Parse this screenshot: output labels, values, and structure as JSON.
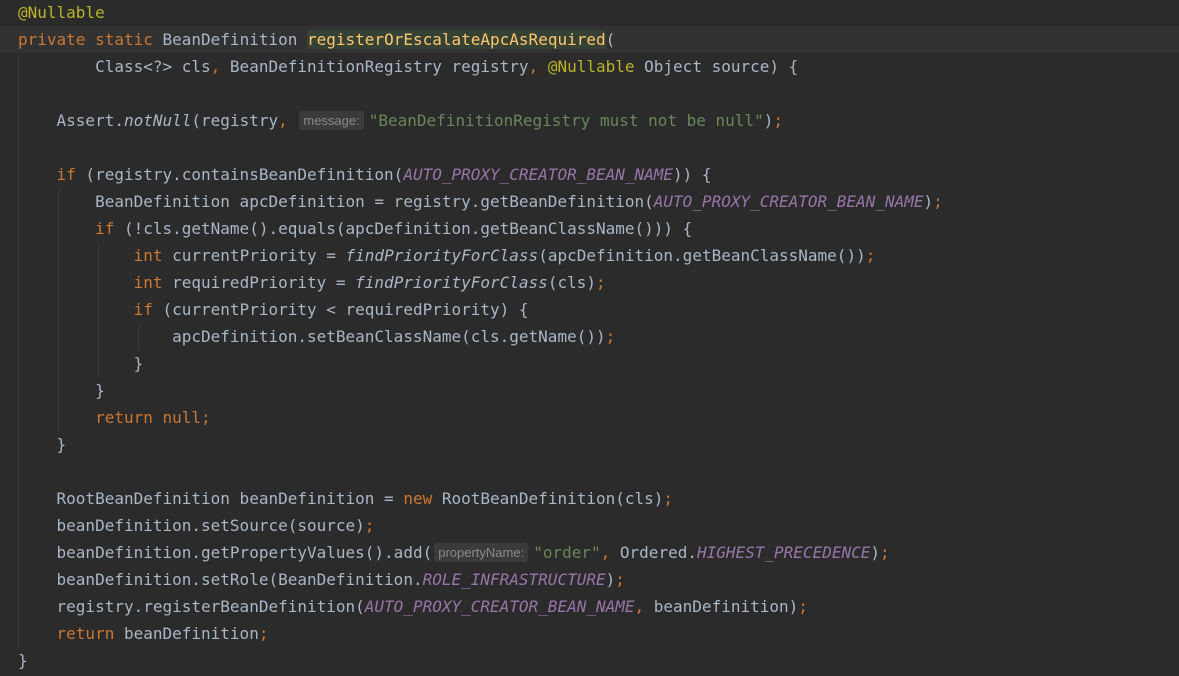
{
  "editor": {
    "theme_colors": {
      "background": "#2b2b2b",
      "current_line": "#323232",
      "keyword": "#cc7832",
      "annotation": "#bbb529",
      "method_declaration": "#ffc66d",
      "constant": "#9876aa",
      "string": "#6a8759",
      "default_text": "#a9b7c6",
      "hint_background": "#3b3b3b",
      "hint_text": "#8a8a8a"
    },
    "lines": [
      {
        "text": [
          {
            "t": "@Nullable",
            "c": "ann"
          }
        ]
      },
      {
        "current": true,
        "text": [
          {
            "t": "private static ",
            "c": "kw"
          },
          {
            "t": "BeanDefinition "
          },
          {
            "t": "registerOrEscalateApcAsRequired",
            "c": "fn-decl fn-hl"
          },
          {
            "t": "("
          }
        ]
      },
      {
        "text": [
          {
            "t": "        Class<?> cls"
          },
          {
            "t": ", ",
            "c": "kw"
          },
          {
            "t": "BeanDefinitionRegistry registry"
          },
          {
            "t": ", ",
            "c": "kw"
          },
          {
            "t": "@Nullable",
            "c": "ann"
          },
          {
            "t": " Object source) {"
          }
        ]
      },
      {
        "text": []
      },
      {
        "text": [
          {
            "t": "    Assert."
          },
          {
            "t": "notNull",
            "c": "static"
          },
          {
            "t": "(registry"
          },
          {
            "t": ", ",
            "c": "kw"
          },
          {
            "hint": "message:"
          },
          {
            "t": "\"BeanDefinitionRegistry must not be null\"",
            "c": "str"
          },
          {
            "t": ")"
          },
          {
            "t": ";",
            "c": "kw"
          }
        ]
      },
      {
        "text": []
      },
      {
        "text": [
          {
            "t": "    "
          },
          {
            "t": "if",
            "c": "kw"
          },
          {
            "t": " (registry.containsBeanDefinition("
          },
          {
            "t": "AUTO_PROXY_CREATOR_BEAN_NAME",
            "c": "const"
          },
          {
            "t": ")) {"
          }
        ]
      },
      {
        "text": [
          {
            "t": "        BeanDefinition apcDefinition = registry.getBeanDefinition("
          },
          {
            "t": "AUTO_PROXY_CREATOR_BEAN_NAME",
            "c": "const"
          },
          {
            "t": ")"
          },
          {
            "t": ";",
            "c": "kw"
          }
        ]
      },
      {
        "text": [
          {
            "t": "        "
          },
          {
            "t": "if",
            "c": "kw"
          },
          {
            "t": " (!cls.getName().equals(apcDefinition.getBeanClassName())) {"
          }
        ]
      },
      {
        "text": [
          {
            "t": "            "
          },
          {
            "t": "int",
            "c": "kw"
          },
          {
            "t": " currentPriority = "
          },
          {
            "t": "findPriorityForClass",
            "c": "static"
          },
          {
            "t": "(apcDefinition.getBeanClassName())"
          },
          {
            "t": ";",
            "c": "kw"
          }
        ]
      },
      {
        "text": [
          {
            "t": "            "
          },
          {
            "t": "int",
            "c": "kw"
          },
          {
            "t": " requiredPriority = "
          },
          {
            "t": "findPriorityForClass",
            "c": "static"
          },
          {
            "t": "(cls)"
          },
          {
            "t": ";",
            "c": "kw"
          }
        ]
      },
      {
        "text": [
          {
            "t": "            "
          },
          {
            "t": "if",
            "c": "kw"
          },
          {
            "t": " (currentPriority < requiredPriority) {"
          }
        ]
      },
      {
        "text": [
          {
            "t": "                apcDefinition.setBeanClassName(cls.getName())"
          },
          {
            "t": ";",
            "c": "kw"
          }
        ]
      },
      {
        "text": [
          {
            "t": "            }"
          }
        ]
      },
      {
        "text": [
          {
            "t": "        }"
          }
        ]
      },
      {
        "text": [
          {
            "t": "        "
          },
          {
            "t": "return null",
            "c": "kw"
          },
          {
            "t": ";",
            "c": "kw"
          }
        ]
      },
      {
        "text": [
          {
            "t": "    }"
          }
        ]
      },
      {
        "text": []
      },
      {
        "text": [
          {
            "t": "    RootBeanDefinition beanDefinition = "
          },
          {
            "t": "new",
            "c": "kw"
          },
          {
            "t": " RootBeanDefinition(cls)"
          },
          {
            "t": ";",
            "c": "kw"
          }
        ]
      },
      {
        "text": [
          {
            "t": "    beanDefinition.setSource(source)"
          },
          {
            "t": ";",
            "c": "kw"
          }
        ]
      },
      {
        "text": [
          {
            "t": "    beanDefinition.getPropertyValues().add("
          },
          {
            "hint": "propertyName:"
          },
          {
            "t": "\"order\"",
            "c": "str"
          },
          {
            "t": ", ",
            "c": "kw"
          },
          {
            "t": "Ordered."
          },
          {
            "t": "HIGHEST_PRECEDENCE",
            "c": "const"
          },
          {
            "t": ")"
          },
          {
            "t": ";",
            "c": "kw"
          }
        ]
      },
      {
        "text": [
          {
            "t": "    beanDefinition.setRole(BeanDefinition."
          },
          {
            "t": "ROLE_INFRASTRUCTURE",
            "c": "const"
          },
          {
            "t": ")"
          },
          {
            "t": ";",
            "c": "kw"
          }
        ]
      },
      {
        "text": [
          {
            "t": "    registry.registerBeanDefinition("
          },
          {
            "t": "AUTO_PROXY_CREATOR_BEAN_NAME",
            "c": "const"
          },
          {
            "t": ", ",
            "c": "kw"
          },
          {
            "t": "beanDefinition)"
          },
          {
            "t": ";",
            "c": "kw"
          }
        ]
      },
      {
        "text": [
          {
            "t": "    "
          },
          {
            "t": "return",
            "c": "kw"
          },
          {
            "t": " beanDefinition"
          },
          {
            "t": ";",
            "c": "kw"
          }
        ]
      },
      {
        "text": [
          {
            "t": "}"
          }
        ]
      }
    ]
  }
}
